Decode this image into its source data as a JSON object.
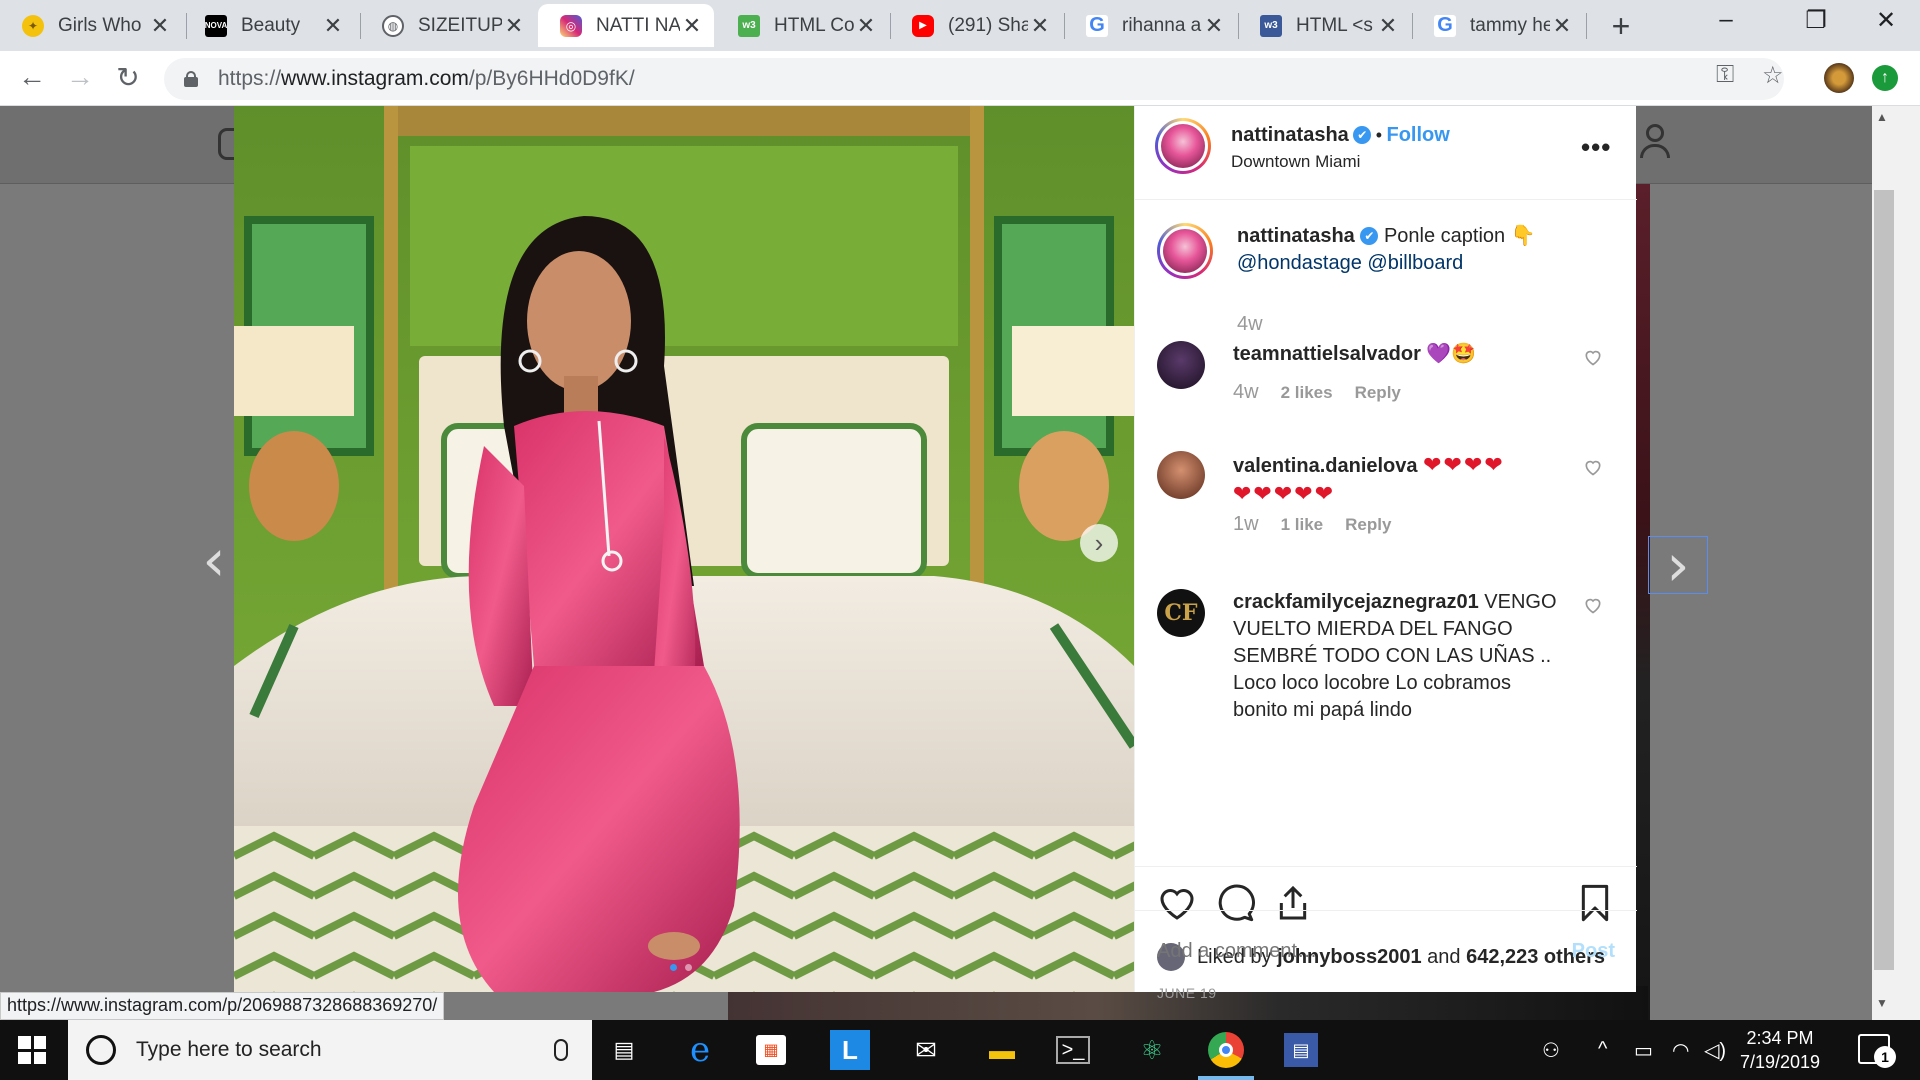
{
  "browser": {
    "tabs": [
      {
        "label": "Girls Who",
        "icon": "lightbulb-icon",
        "color": "#f4c20d"
      },
      {
        "label": "Beauty",
        "icon": "nova-icon",
        "color": "#000000"
      },
      {
        "label": "SIZEITUP.",
        "icon": "globe-icon",
        "color": "#5f6368"
      },
      {
        "label": "NATTI NA",
        "icon": "instagram-icon",
        "color": "#c13584"
      },
      {
        "label": "HTML Col",
        "icon": "w3-icon",
        "color": "#4caf50"
      },
      {
        "label": "(291) Sha",
        "icon": "youtube-icon",
        "color": "#ff0000"
      },
      {
        "label": "rihanna a",
        "icon": "google-icon",
        "color": "#4285f4"
      },
      {
        "label": "HTML <s",
        "icon": "w3schools-icon",
        "color": "#3b5998"
      },
      {
        "label": "tammy he",
        "icon": "google-icon",
        "color": "#4285f4"
      }
    ],
    "active_tab": 3,
    "close_glyph": "✕",
    "new_tab": "+",
    "window_controls": {
      "minimize": "–",
      "maximize": "❐",
      "close": "✕"
    },
    "url_scheme": "https://",
    "url_host": "www.instagram.com",
    "url_path": "/p/By6HHd0D9fK/",
    "status_url": "https://www.instagram.com/p/2069887328688369270/"
  },
  "post": {
    "username": "nattinatasha",
    "verified": "✔",
    "separator": "•",
    "follow_label": "Follow",
    "location": "Downtown Miami",
    "more": "•••",
    "caption": {
      "text": "Ponle caption 👇",
      "mentions": "@hondastage @billboard",
      "age": "4w"
    },
    "comments": [
      {
        "user": "teamnattielsalvador",
        "text": "💜🤩",
        "age": "4w",
        "likes": "2 likes",
        "reply": "Reply",
        "avatar_color": "#2a1a30"
      },
      {
        "user": "valentina.danielova",
        "text": "❤❤❤❤",
        "text2": "❤❤❤❤❤",
        "age": "1w",
        "likes": "1 like",
        "reply": "Reply",
        "avatar_color": "#8a4a30"
      },
      {
        "user": "crackfamilycejaznegraz01",
        "text": "VENGO VUELTO MIERDA DEL FANGO SEMBRÉ TODO CON LAS UÑAS .. Loco loco locobre Lo cobramos bonito mi papá lindo",
        "avatar_color": "#111111"
      }
    ],
    "liked_by_prefix": "Liked by",
    "liked_by_user": "johnyboss2001",
    "liked_by_and": "and",
    "liked_by_count": "642,223 others",
    "date": "JUNE 19",
    "comment_placeholder": "Add a comment…",
    "post_label": "Post",
    "carousel": {
      "slides": 2,
      "current": 1
    }
  },
  "taskbar": {
    "search_placeholder": "Type here to search",
    "time": "2:34 PM",
    "date": "7/19/2019",
    "notifications": "1"
  },
  "colors": {
    "instagram_blue": "#3897f0",
    "tab_strip": "#dee1e6"
  }
}
